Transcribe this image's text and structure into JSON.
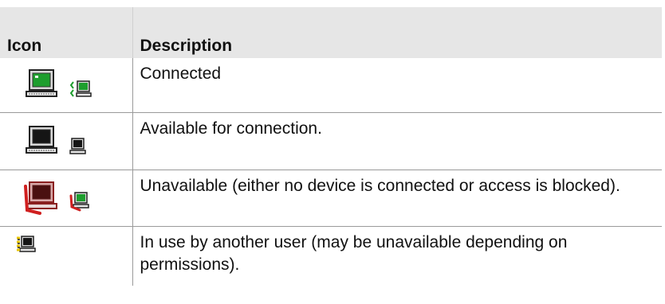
{
  "table": {
    "headers": {
      "icon": "Icon",
      "description": "Description"
    },
    "rows": [
      {
        "description": "Connected",
        "icons": [
          "pc-green-large-icon",
          "pc-green-small-icon"
        ]
      },
      {
        "description": "Available for connection.",
        "icons": [
          "pc-large-icon",
          "pc-small-icon"
        ]
      },
      {
        "description": "Unavailable (either no device is connected or access is blocked).",
        "icons": [
          "pc-blocked-large-icon",
          "pc-blocked-small-icon"
        ]
      },
      {
        "description": "In use by another user (may be unavailable depending on permissions).",
        "icons": [
          "pc-in-use-icon"
        ]
      }
    ]
  },
  "colors": {
    "header_background": "#e6e6e6",
    "connected_screen": "#1e9e2e",
    "blocked_red": "#d02020",
    "in_use_yellow": "#e8c400"
  }
}
